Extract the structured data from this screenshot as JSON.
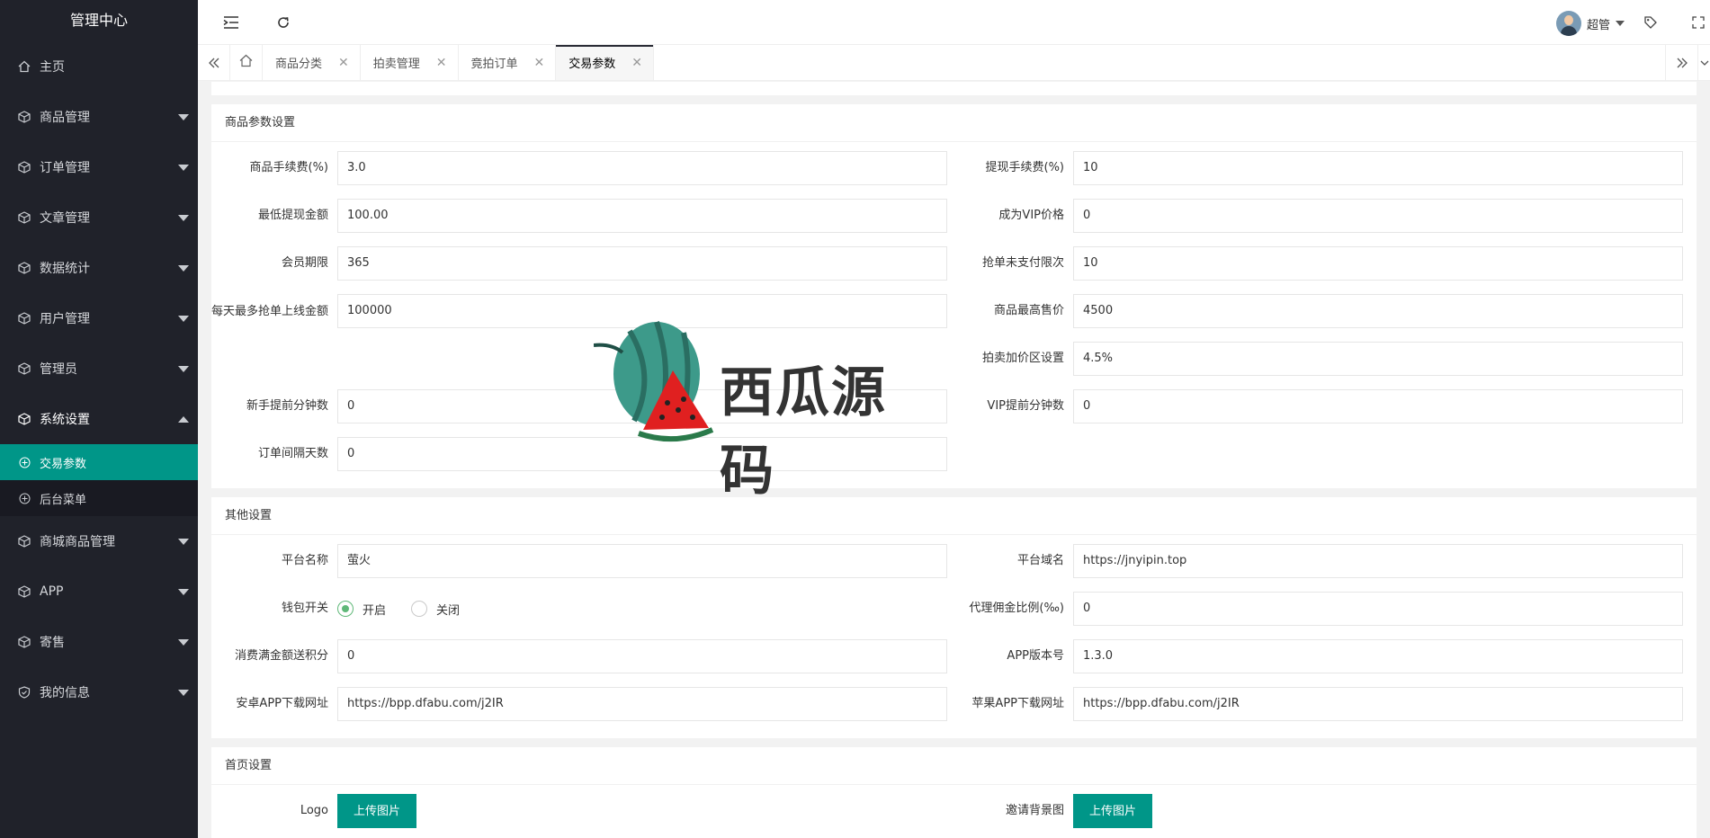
{
  "sidebar": {
    "title": "管理中心",
    "items": [
      {
        "label": "主页",
        "icon": "home-icon",
        "caret": false
      },
      {
        "label": "商品管理",
        "icon": "cube-icon",
        "caret": true
      },
      {
        "label": "订单管理",
        "icon": "cube-icon",
        "caret": true
      },
      {
        "label": "文章管理",
        "icon": "cube-icon",
        "caret": true
      },
      {
        "label": "数据统计",
        "icon": "cube-icon",
        "caret": true
      },
      {
        "label": "用户管理",
        "icon": "cube-icon",
        "caret": true
      },
      {
        "label": "管理员",
        "icon": "cube-icon",
        "caret": true
      },
      {
        "label": "系统设置",
        "icon": "cube-icon",
        "caret": true,
        "expanded": true
      }
    ],
    "sub_items": [
      {
        "label": "交易参数",
        "active": true
      },
      {
        "label": "后台菜单",
        "active": false
      }
    ],
    "items_after": [
      {
        "label": "商城商品管理"
      },
      {
        "label": "APP"
      },
      {
        "label": "寄售"
      },
      {
        "label": "我的信息"
      }
    ]
  },
  "header": {
    "user_name": "超管"
  },
  "tabs": [
    {
      "label": "商品分类",
      "active": false
    },
    {
      "label": "拍卖管理",
      "active": false
    },
    {
      "label": "竟拍订单",
      "active": false
    },
    {
      "label": "交易参数",
      "active": true
    }
  ],
  "goods_params": {
    "title": "商品参数设置",
    "left": [
      {
        "label": "商品手续费(%)",
        "value": "3.0"
      },
      {
        "label": "最低提现金额",
        "value": "100.00"
      },
      {
        "label": "会员期限",
        "value": "365"
      },
      {
        "label": "每天最多抢单上线金额",
        "value": "100000"
      },
      {
        "label": "",
        "value": ""
      },
      {
        "label": "新手提前分钟数",
        "value": "0"
      },
      {
        "label": "订单间隔天数",
        "value": "0"
      }
    ],
    "right": [
      {
        "label": "提现手续费(%)",
        "value": "10"
      },
      {
        "label": "成为VIP价格",
        "value": "0"
      },
      {
        "label": "抢单未支付限次",
        "value": "10"
      },
      {
        "label": "商品最高售价",
        "value": "4500"
      },
      {
        "label": "拍卖加价区设置",
        "value": "4.5%"
      },
      {
        "label": "VIP提前分钟数",
        "value": "0"
      }
    ]
  },
  "other": {
    "title": "其他设置",
    "platform_name_label": "平台名称",
    "platform_name": "萤火",
    "platform_domain_label": "平台域名",
    "platform_domain": "https://jnyipin.top",
    "wallet_label": "钱包开关",
    "wallet_on": "开启",
    "wallet_off": "关闭",
    "agent_ratio_label": "代理佣金比例(‰)",
    "agent_ratio": "0",
    "points_label": "消费满金额送积分",
    "points": "0",
    "app_version_label": "APP版本号",
    "app_version": "1.3.0",
    "android_label": "安卓APP下载网址",
    "android_url": "https://bpp.dfabu.com/j2IR",
    "ios_label": "苹果APP下载网址",
    "ios_url": "https://bpp.dfabu.com/j2IR"
  },
  "home": {
    "title": "首页设置",
    "logo_label": "Logo",
    "logo_btn": "上传图片",
    "invite_label": "邀请背景图",
    "invite_btn": "上传图片"
  },
  "watermark": {
    "text": "西瓜源码"
  },
  "colors": {
    "sidebar_bg": "#20222a",
    "accent": "#009688",
    "radio_on": "#5fb878"
  }
}
